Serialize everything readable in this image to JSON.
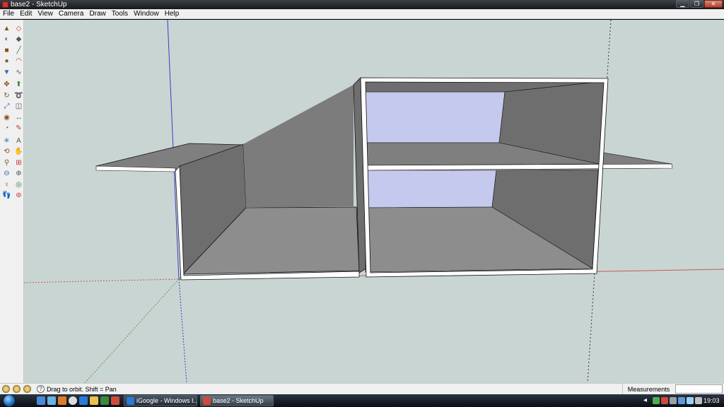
{
  "window": {
    "title": "base2 - SketchUp",
    "minimize": "▁",
    "maximize": "❐",
    "close": "✕"
  },
  "menu": [
    "File",
    "Edit",
    "View",
    "Camera",
    "Draw",
    "Tools",
    "Window",
    "Help"
  ],
  "toolbar": {
    "tools": [
      "select-tool",
      "eraser-tool",
      "paint-bucket-tool",
      "eraser-alt-tool",
      "rectangle-tool",
      "line-tool",
      "circle-tool",
      "arc-tool",
      "polygon-tool",
      "freehand-tool",
      "move-tool",
      "push-pull-tool",
      "rotate-tool",
      "follow-me-tool",
      "scale-tool",
      "offset-tool",
      "tape-measure-tool",
      "dimension-tool",
      "protractor-tool",
      "text-tool",
      "axes-tool",
      "3d-text-tool",
      "orbit-tool",
      "pan-tool",
      "zoom-tool",
      "zoom-window-tool",
      "zoom-previous-tool",
      "zoom-extents-tool",
      "position-camera-tool",
      "look-around-tool",
      "walk-tool",
      "section-plane-tool"
    ]
  },
  "status": {
    "hint": "Drag to orbit.  Shift = Pan",
    "help_icon": "?",
    "measurements_label": "Measurements",
    "measurements_value": ""
  },
  "taskbar": {
    "tasks": [
      {
        "label": "iGoogle - Windows I...",
        "active": false
      },
      {
        "label": "base2 - SketchUp",
        "active": true
      }
    ],
    "tray_chevron": "◂",
    "clock": "19:03"
  },
  "colors": {
    "viewport_bg": "#c9d5d3",
    "face_dark": "#6e6e6e",
    "face_mid": "#7f7f7f",
    "face_floor": "#8d8d8d",
    "face_light": "#c6c9ee",
    "edge_white": "#ffffff",
    "axis_red": "#c45a5a",
    "axis_green": "#4ea24e",
    "axis_blue": "#3c3cc8"
  }
}
